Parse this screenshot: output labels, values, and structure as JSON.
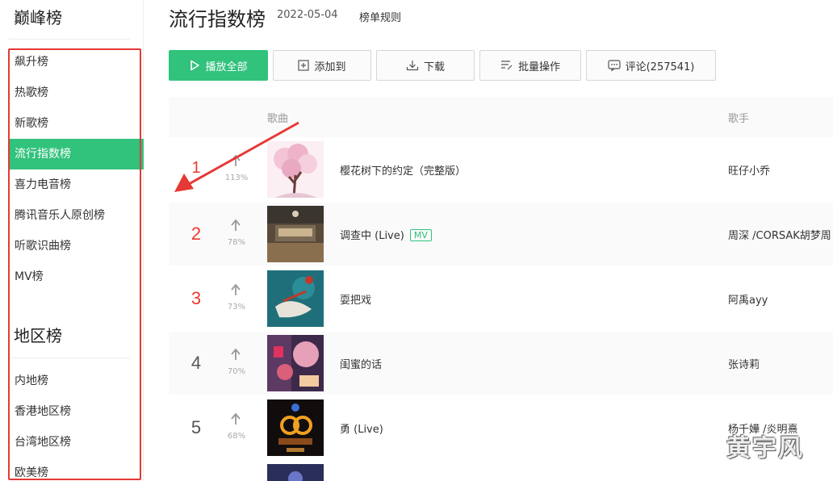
{
  "sidebar": {
    "section1_title": "巅峰榜",
    "section2_title": "地区榜",
    "peak_items": [
      "飙升榜",
      "热歌榜",
      "新歌榜",
      "流行指数榜",
      "喜力电音榜",
      "腾讯音乐人原创榜",
      "听歌识曲榜",
      "MV榜"
    ],
    "active_index": 3,
    "region_items": [
      "内地榜",
      "香港地区榜",
      "台湾地区榜",
      "欧美榜"
    ]
  },
  "header": {
    "title": "流行指数榜",
    "date": "2022-05-04",
    "rules_link": "榜单规则"
  },
  "toolbar": {
    "play_all": "播放全部",
    "add_to": "添加到",
    "download": "下载",
    "batch": "批量操作",
    "comments": "评论(257541)"
  },
  "table": {
    "col_song": "歌曲",
    "col_artist": "歌手",
    "rows": [
      {
        "rank": "1",
        "trend": "113%",
        "title": "樱花树下的约定（完整版）",
        "mv": "",
        "artist": "旺仔小乔"
      },
      {
        "rank": "2",
        "trend": "78%",
        "title": "调查中 (Live)",
        "mv": "MV",
        "artist": "周深 /CORSAK胡梦周"
      },
      {
        "rank": "3",
        "trend": "73%",
        "title": "耍把戏",
        "mv": "",
        "artist": "阿禹ayy"
      },
      {
        "rank": "4",
        "trend": "70%",
        "title": "闺蜜的话",
        "mv": "",
        "artist": "张诗莉"
      },
      {
        "rank": "5",
        "trend": "68%",
        "title": "勇 (Live)",
        "mv": "",
        "artist": "杨千嬅 /炎明熹"
      }
    ]
  },
  "watermark": "黄宇风",
  "colors": {
    "accent": "#31c27c",
    "rank_hot": "#e83a2f",
    "annotation": "#e53935"
  }
}
